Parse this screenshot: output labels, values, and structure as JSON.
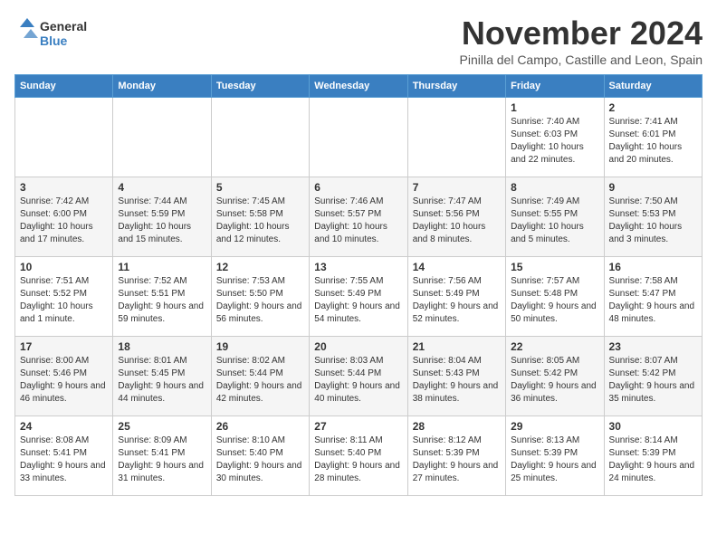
{
  "logo": {
    "line1": "General",
    "line2": "Blue"
  },
  "header": {
    "month": "November 2024",
    "location": "Pinilla del Campo, Castille and Leon, Spain"
  },
  "weekdays": [
    "Sunday",
    "Monday",
    "Tuesday",
    "Wednesday",
    "Thursday",
    "Friday",
    "Saturday"
  ],
  "weeks": [
    [
      {
        "day": "",
        "info": ""
      },
      {
        "day": "",
        "info": ""
      },
      {
        "day": "",
        "info": ""
      },
      {
        "day": "",
        "info": ""
      },
      {
        "day": "",
        "info": ""
      },
      {
        "day": "1",
        "info": "Sunrise: 7:40 AM\nSunset: 6:03 PM\nDaylight: 10 hours and 22 minutes."
      },
      {
        "day": "2",
        "info": "Sunrise: 7:41 AM\nSunset: 6:01 PM\nDaylight: 10 hours and 20 minutes."
      }
    ],
    [
      {
        "day": "3",
        "info": "Sunrise: 7:42 AM\nSunset: 6:00 PM\nDaylight: 10 hours and 17 minutes."
      },
      {
        "day": "4",
        "info": "Sunrise: 7:44 AM\nSunset: 5:59 PM\nDaylight: 10 hours and 15 minutes."
      },
      {
        "day": "5",
        "info": "Sunrise: 7:45 AM\nSunset: 5:58 PM\nDaylight: 10 hours and 12 minutes."
      },
      {
        "day": "6",
        "info": "Sunrise: 7:46 AM\nSunset: 5:57 PM\nDaylight: 10 hours and 10 minutes."
      },
      {
        "day": "7",
        "info": "Sunrise: 7:47 AM\nSunset: 5:56 PM\nDaylight: 10 hours and 8 minutes."
      },
      {
        "day": "8",
        "info": "Sunrise: 7:49 AM\nSunset: 5:55 PM\nDaylight: 10 hours and 5 minutes."
      },
      {
        "day": "9",
        "info": "Sunrise: 7:50 AM\nSunset: 5:53 PM\nDaylight: 10 hours and 3 minutes."
      }
    ],
    [
      {
        "day": "10",
        "info": "Sunrise: 7:51 AM\nSunset: 5:52 PM\nDaylight: 10 hours and 1 minute."
      },
      {
        "day": "11",
        "info": "Sunrise: 7:52 AM\nSunset: 5:51 PM\nDaylight: 9 hours and 59 minutes."
      },
      {
        "day": "12",
        "info": "Sunrise: 7:53 AM\nSunset: 5:50 PM\nDaylight: 9 hours and 56 minutes."
      },
      {
        "day": "13",
        "info": "Sunrise: 7:55 AM\nSunset: 5:49 PM\nDaylight: 9 hours and 54 minutes."
      },
      {
        "day": "14",
        "info": "Sunrise: 7:56 AM\nSunset: 5:49 PM\nDaylight: 9 hours and 52 minutes."
      },
      {
        "day": "15",
        "info": "Sunrise: 7:57 AM\nSunset: 5:48 PM\nDaylight: 9 hours and 50 minutes."
      },
      {
        "day": "16",
        "info": "Sunrise: 7:58 AM\nSunset: 5:47 PM\nDaylight: 9 hours and 48 minutes."
      }
    ],
    [
      {
        "day": "17",
        "info": "Sunrise: 8:00 AM\nSunset: 5:46 PM\nDaylight: 9 hours and 46 minutes."
      },
      {
        "day": "18",
        "info": "Sunrise: 8:01 AM\nSunset: 5:45 PM\nDaylight: 9 hours and 44 minutes."
      },
      {
        "day": "19",
        "info": "Sunrise: 8:02 AM\nSunset: 5:44 PM\nDaylight: 9 hours and 42 minutes."
      },
      {
        "day": "20",
        "info": "Sunrise: 8:03 AM\nSunset: 5:44 PM\nDaylight: 9 hours and 40 minutes."
      },
      {
        "day": "21",
        "info": "Sunrise: 8:04 AM\nSunset: 5:43 PM\nDaylight: 9 hours and 38 minutes."
      },
      {
        "day": "22",
        "info": "Sunrise: 8:05 AM\nSunset: 5:42 PM\nDaylight: 9 hours and 36 minutes."
      },
      {
        "day": "23",
        "info": "Sunrise: 8:07 AM\nSunset: 5:42 PM\nDaylight: 9 hours and 35 minutes."
      }
    ],
    [
      {
        "day": "24",
        "info": "Sunrise: 8:08 AM\nSunset: 5:41 PM\nDaylight: 9 hours and 33 minutes."
      },
      {
        "day": "25",
        "info": "Sunrise: 8:09 AM\nSunset: 5:41 PM\nDaylight: 9 hours and 31 minutes."
      },
      {
        "day": "26",
        "info": "Sunrise: 8:10 AM\nSunset: 5:40 PM\nDaylight: 9 hours and 30 minutes."
      },
      {
        "day": "27",
        "info": "Sunrise: 8:11 AM\nSunset: 5:40 PM\nDaylight: 9 hours and 28 minutes."
      },
      {
        "day": "28",
        "info": "Sunrise: 8:12 AM\nSunset: 5:39 PM\nDaylight: 9 hours and 27 minutes."
      },
      {
        "day": "29",
        "info": "Sunrise: 8:13 AM\nSunset: 5:39 PM\nDaylight: 9 hours and 25 minutes."
      },
      {
        "day": "30",
        "info": "Sunrise: 8:14 AM\nSunset: 5:39 PM\nDaylight: 9 hours and 24 minutes."
      }
    ]
  ]
}
